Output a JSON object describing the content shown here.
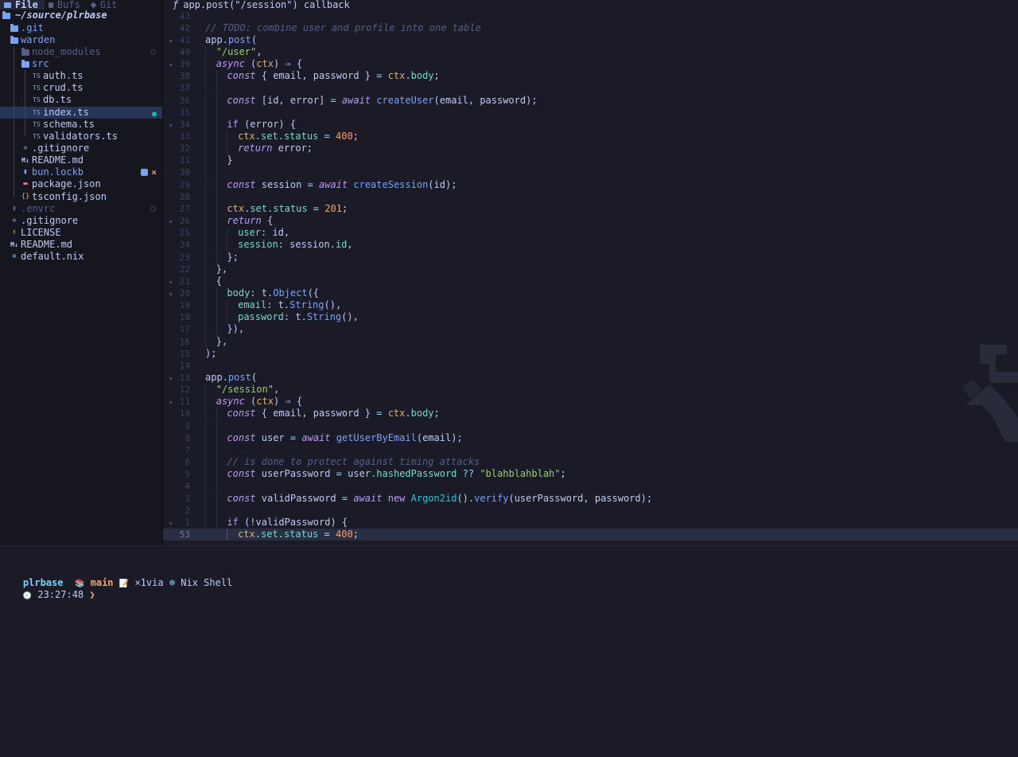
{
  "sidebar": {
    "tabs": [
      {
        "label": "File",
        "icon": "folder-icon",
        "active": true
      },
      {
        "label": "Bufs",
        "icon": "buffer-icon",
        "active": false
      },
      {
        "label": "Git",
        "icon": "git-icon",
        "active": false
      }
    ],
    "root": "~/source/plrbase",
    "tree": [
      {
        "label": ".git",
        "type": "folder",
        "color": "#7aa2f7",
        "depth": 1,
        "text_color": "#7aa2f7"
      },
      {
        "label": "warden",
        "type": "folder-open",
        "color": "#7aa2f7",
        "depth": 1,
        "text_color": "#7aa2f7"
      },
      {
        "label": "node_modules",
        "type": "folder",
        "color": "#565f89",
        "depth": 2,
        "text_color": "#565f89",
        "marker": "circle"
      },
      {
        "label": "src",
        "type": "folder-open",
        "color": "#7aa2f7",
        "depth": 2,
        "text_color": "#7aa2f7"
      },
      {
        "label": "auth.ts",
        "type": "ts",
        "depth": 3,
        "text_color": "#c0caf5"
      },
      {
        "label": "crud.ts",
        "type": "ts",
        "depth": 3,
        "text_color": "#c0caf5"
      },
      {
        "label": "db.ts",
        "type": "ts",
        "depth": 3,
        "text_color": "#c0caf5"
      },
      {
        "label": "index.ts",
        "type": "ts",
        "depth": 3,
        "text_color": "#c0caf5",
        "selected": true,
        "marker": "bulb"
      },
      {
        "label": "schema.ts",
        "type": "ts",
        "depth": 3,
        "text_color": "#c0caf5"
      },
      {
        "label": "validators.ts",
        "type": "ts",
        "depth": 3,
        "text_color": "#c0caf5"
      },
      {
        "label": ".gitignore",
        "type": "git",
        "depth": 2,
        "text_color": "#c0caf5"
      },
      {
        "label": "README.md",
        "type": "md",
        "depth": 2,
        "text_color": "#c0caf5"
      },
      {
        "label": "bun.lockb",
        "type": "file",
        "depth": 2,
        "text_color": "#7aa2f7",
        "marker": "edit-x"
      },
      {
        "label": "package.json",
        "type": "npm",
        "depth": 2,
        "text_color": "#c0caf5"
      },
      {
        "label": "tsconfig.json",
        "type": "json",
        "depth": 2,
        "text_color": "#c0caf5"
      },
      {
        "label": ".envrc",
        "type": "file-dim",
        "depth": 1,
        "text_color": "#565f89",
        "marker": "circle"
      },
      {
        "label": ".gitignore",
        "type": "git",
        "depth": 1,
        "text_color": "#c0caf5"
      },
      {
        "label": "LICENSE",
        "type": "license",
        "depth": 1,
        "text_color": "#c0caf5"
      },
      {
        "label": "README.md",
        "type": "md",
        "depth": 1,
        "text_color": "#c0caf5"
      },
      {
        "label": "default.nix",
        "type": "nix",
        "depth": 1,
        "text_color": "#c0caf5"
      }
    ]
  },
  "editor": {
    "breadcrumb_icon": "ƒ",
    "breadcrumb": "app.post(\"/session\") callback",
    "lines": [
      {
        "n": "43",
        "indent": 0,
        "tokens": []
      },
      {
        "n": "42",
        "indent": 0,
        "tokens": [
          [
            "cm",
            "// TODO: combine user and profile into one table"
          ]
        ]
      },
      {
        "n": "41",
        "fold": true,
        "indent": 0,
        "tokens": [
          [
            "va",
            "app"
          ],
          [
            "op",
            "."
          ],
          [
            "fn",
            "post"
          ],
          [
            "va",
            "("
          ]
        ]
      },
      {
        "n": "40",
        "indent": 1,
        "tokens": [
          [
            "st",
            "\"/user\""
          ],
          [
            "va",
            ","
          ]
        ]
      },
      {
        "n": "39",
        "fold": true,
        "indent": 1,
        "tokens": [
          [
            "k",
            "async"
          ],
          [
            "va",
            " ("
          ],
          [
            "pa",
            "ctx"
          ],
          [
            "va",
            ") "
          ],
          [
            "k",
            "⇒"
          ],
          [
            "va",
            " {"
          ]
        ]
      },
      {
        "n": "38",
        "indent": 2,
        "tokens": [
          [
            "k",
            "const"
          ],
          [
            "va",
            " { email, password } "
          ],
          [
            "op",
            "="
          ],
          [
            "va",
            " "
          ],
          [
            "pa",
            "ctx"
          ],
          [
            "op",
            "."
          ],
          [
            "pr",
            "body"
          ],
          [
            "va",
            ";"
          ]
        ]
      },
      {
        "n": "37",
        "indent": 2,
        "tokens": []
      },
      {
        "n": "36",
        "indent": 2,
        "tokens": [
          [
            "k",
            "const"
          ],
          [
            "va",
            " [id, error] "
          ],
          [
            "op",
            "="
          ],
          [
            "va",
            " "
          ],
          [
            "k",
            "await"
          ],
          [
            "va",
            " "
          ],
          [
            "fn",
            "createUser"
          ],
          [
            "va",
            "(email, password);"
          ]
        ]
      },
      {
        "n": "35",
        "indent": 2,
        "tokens": []
      },
      {
        "n": "34",
        "fold": true,
        "indent": 2,
        "tokens": [
          [
            "kn",
            "if"
          ],
          [
            "va",
            " (error) {"
          ]
        ]
      },
      {
        "n": "33",
        "indent": 3,
        "tokens": [
          [
            "pa",
            "ctx"
          ],
          [
            "op",
            "."
          ],
          [
            "pr",
            "set"
          ],
          [
            "op",
            "."
          ],
          [
            "pr",
            "status"
          ],
          [
            "va",
            " "
          ],
          [
            "op",
            "="
          ],
          [
            "va",
            " "
          ],
          [
            "nu",
            "400"
          ],
          [
            "va",
            ";"
          ]
        ]
      },
      {
        "n": "32",
        "indent": 3,
        "tokens": [
          [
            "k",
            "return"
          ],
          [
            "va",
            " error;"
          ]
        ]
      },
      {
        "n": "31",
        "indent": 2,
        "tokens": [
          [
            "va",
            "}"
          ]
        ]
      },
      {
        "n": "30",
        "indent": 2,
        "tokens": []
      },
      {
        "n": "29",
        "indent": 2,
        "tokens": [
          [
            "k",
            "const"
          ],
          [
            "va",
            " session "
          ],
          [
            "op",
            "="
          ],
          [
            "va",
            " "
          ],
          [
            "k",
            "await"
          ],
          [
            "va",
            " "
          ],
          [
            "fn",
            "createSession"
          ],
          [
            "va",
            "(id);"
          ]
        ]
      },
      {
        "n": "28",
        "indent": 2,
        "tokens": []
      },
      {
        "n": "27",
        "indent": 2,
        "tokens": [
          [
            "pa",
            "ctx"
          ],
          [
            "op",
            "."
          ],
          [
            "pr",
            "set"
          ],
          [
            "op",
            "."
          ],
          [
            "pr",
            "status"
          ],
          [
            "va",
            " "
          ],
          [
            "op",
            "="
          ],
          [
            "va",
            " "
          ],
          [
            "nu",
            "201"
          ],
          [
            "va",
            ";"
          ]
        ]
      },
      {
        "n": "26",
        "fold": true,
        "indent": 2,
        "tokens": [
          [
            "k",
            "return"
          ],
          [
            "va",
            " {"
          ]
        ]
      },
      {
        "n": "25",
        "indent": 3,
        "tokens": [
          [
            "pr",
            "user"
          ],
          [
            "va",
            ": id,"
          ]
        ]
      },
      {
        "n": "24",
        "indent": 3,
        "tokens": [
          [
            "pr",
            "session"
          ],
          [
            "va",
            ": session"
          ],
          [
            "op",
            "."
          ],
          [
            "pr",
            "id"
          ],
          [
            "va",
            ","
          ]
        ]
      },
      {
        "n": "23",
        "indent": 2,
        "tokens": [
          [
            "va",
            "};"
          ]
        ]
      },
      {
        "n": "22",
        "indent": 1,
        "tokens": [
          [
            "va",
            "},"
          ]
        ]
      },
      {
        "n": "21",
        "fold": true,
        "indent": 1,
        "tokens": [
          [
            "va",
            "{"
          ]
        ]
      },
      {
        "n": "20",
        "fold": true,
        "indent": 2,
        "tokens": [
          [
            "pr",
            "body"
          ],
          [
            "va",
            ": t"
          ],
          [
            "op",
            "."
          ],
          [
            "fn",
            "Object"
          ],
          [
            "va",
            "({"
          ]
        ]
      },
      {
        "n": "19",
        "indent": 3,
        "tokens": [
          [
            "pr",
            "email"
          ],
          [
            "va",
            ": t"
          ],
          [
            "op",
            "."
          ],
          [
            "fn",
            "String"
          ],
          [
            "va",
            "(),"
          ]
        ]
      },
      {
        "n": "18",
        "indent": 3,
        "tokens": [
          [
            "pr",
            "password"
          ],
          [
            "va",
            ": t"
          ],
          [
            "op",
            "."
          ],
          [
            "fn",
            "String"
          ],
          [
            "va",
            "(),"
          ]
        ]
      },
      {
        "n": "17",
        "indent": 2,
        "tokens": [
          [
            "va",
            "}),"
          ]
        ]
      },
      {
        "n": "16",
        "indent": 1,
        "tokens": [
          [
            "va",
            "},"
          ]
        ]
      },
      {
        "n": "15",
        "indent": 0,
        "tokens": [
          [
            "va",
            ");"
          ]
        ]
      },
      {
        "n": "14",
        "indent": 0,
        "tokens": []
      },
      {
        "n": "13",
        "fold": true,
        "indent": 0,
        "tokens": [
          [
            "va",
            "app"
          ],
          [
            "op",
            "."
          ],
          [
            "fn",
            "post"
          ],
          [
            "va",
            "("
          ]
        ]
      },
      {
        "n": "12",
        "indent": 1,
        "tokens": [
          [
            "st",
            "\"/session\""
          ],
          [
            "va",
            ","
          ]
        ]
      },
      {
        "n": "11",
        "fold": true,
        "indent": 1,
        "tokens": [
          [
            "k",
            "async"
          ],
          [
            "va",
            " ("
          ],
          [
            "pa",
            "ctx"
          ],
          [
            "va",
            ") "
          ],
          [
            "k",
            "⇒"
          ],
          [
            "va",
            " {"
          ]
        ]
      },
      {
        "n": "10",
        "indent": 2,
        "tokens": [
          [
            "k",
            "const"
          ],
          [
            "va",
            " { email, password } "
          ],
          [
            "op",
            "="
          ],
          [
            "va",
            " "
          ],
          [
            "pa",
            "ctx"
          ],
          [
            "op",
            "."
          ],
          [
            "pr",
            "body"
          ],
          [
            "va",
            ";"
          ]
        ]
      },
      {
        "n": "9",
        "indent": 2,
        "tokens": []
      },
      {
        "n": "8",
        "indent": 2,
        "tokens": [
          [
            "k",
            "const"
          ],
          [
            "va",
            " user "
          ],
          [
            "op",
            "="
          ],
          [
            "va",
            " "
          ],
          [
            "k",
            "await"
          ],
          [
            "va",
            " "
          ],
          [
            "fn",
            "getUserByEmail"
          ],
          [
            "va",
            "(email);"
          ]
        ]
      },
      {
        "n": "7",
        "indent": 2,
        "tokens": []
      },
      {
        "n": "6",
        "indent": 2,
        "tokens": [
          [
            "cm",
            "// is done to protect against timing attacks"
          ]
        ]
      },
      {
        "n": "5",
        "indent": 2,
        "tokens": [
          [
            "k",
            "const"
          ],
          [
            "va",
            " userPassword "
          ],
          [
            "op",
            "="
          ],
          [
            "va",
            " user"
          ],
          [
            "op",
            "."
          ],
          [
            "pr",
            "hashedPassword"
          ],
          [
            "va",
            " "
          ],
          [
            "op",
            "??"
          ],
          [
            "va",
            " "
          ],
          [
            "st",
            "\"blahblahblah\""
          ],
          [
            "va",
            ";"
          ]
        ]
      },
      {
        "n": "4",
        "indent": 2,
        "tokens": []
      },
      {
        "n": "3",
        "indent": 2,
        "tokens": [
          [
            "k",
            "const"
          ],
          [
            "va",
            " validPassword "
          ],
          [
            "op",
            "="
          ],
          [
            "va",
            " "
          ],
          [
            "k",
            "await"
          ],
          [
            "va",
            " "
          ],
          [
            "kn",
            "new"
          ],
          [
            "va",
            " "
          ],
          [
            "ty",
            "Argon2id"
          ],
          [
            "va",
            "()"
          ],
          [
            "op",
            "."
          ],
          [
            "fn",
            "verify"
          ],
          [
            "va",
            "(userPassword, password);"
          ]
        ]
      },
      {
        "n": "2",
        "indent": 2,
        "tokens": []
      },
      {
        "n": "1",
        "fold": true,
        "indent": 2,
        "tokens": [
          [
            "kn",
            "if"
          ],
          [
            "va",
            " ("
          ],
          [
            "op",
            "!"
          ],
          [
            "va",
            "validPassword) {"
          ]
        ]
      },
      {
        "n": "53",
        "current": true,
        "indent": 3,
        "tokens": [
          [
            "pa",
            "ctx"
          ],
          [
            "op",
            "."
          ],
          [
            "pr",
            "set"
          ],
          [
            "op",
            "."
          ],
          [
            "pr",
            "status"
          ],
          [
            "va",
            " "
          ],
          [
            "op",
            "="
          ],
          [
            "va",
            " "
          ],
          [
            "nu",
            "400"
          ],
          [
            "va",
            ";"
          ]
        ]
      }
    ]
  },
  "terminal": {
    "dir": "plrbase",
    "branch_icon": "📚",
    "branch": "main",
    "status_icon": "📝",
    "status": "×1via",
    "shell_icon": "❄",
    "shell": "Nix Shell",
    "clock_icon": "🕘",
    "time": "23:27:48",
    "prompt": "❯"
  }
}
